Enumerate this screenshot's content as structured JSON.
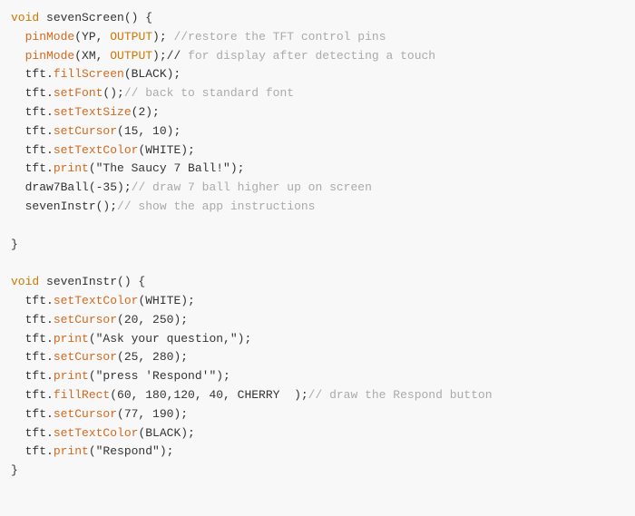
{
  "code": {
    "lines": [
      {
        "id": 1,
        "tokens": [
          {
            "t": "void",
            "c": "kw"
          },
          {
            "t": " sevenScreen() {",
            "c": "plain"
          }
        ]
      },
      {
        "id": 2,
        "tokens": [
          {
            "t": "  pinMode",
            "c": "method"
          },
          {
            "t": "(YP, ",
            "c": "plain"
          },
          {
            "t": "OUTPUT",
            "c": "param"
          },
          {
            "t": "); ",
            "c": "plain"
          },
          {
            "t": "//restore the TFT control pins",
            "c": "comment"
          }
        ]
      },
      {
        "id": 3,
        "tokens": [
          {
            "t": "  pinMode",
            "c": "method"
          },
          {
            "t": "(XM, ",
            "c": "plain"
          },
          {
            "t": "OUTPUT",
            "c": "param"
          },
          {
            "t": ");//",
            "c": "plain"
          },
          {
            "t": " for display after detecting a touch",
            "c": "comment"
          }
        ]
      },
      {
        "id": 4,
        "tokens": [
          {
            "t": "  tft.",
            "c": "plain"
          },
          {
            "t": "fillScreen",
            "c": "method"
          },
          {
            "t": "(BLACK);",
            "c": "plain"
          }
        ]
      },
      {
        "id": 5,
        "tokens": [
          {
            "t": "  tft.",
            "c": "plain"
          },
          {
            "t": "setFont",
            "c": "method"
          },
          {
            "t": "();",
            "c": "plain"
          },
          {
            "t": "// back to standard font",
            "c": "comment"
          }
        ]
      },
      {
        "id": 6,
        "tokens": [
          {
            "t": "  tft.",
            "c": "plain"
          },
          {
            "t": "setTextSize",
            "c": "method"
          },
          {
            "t": "(2);",
            "c": "plain"
          }
        ]
      },
      {
        "id": 7,
        "tokens": [
          {
            "t": "  tft.",
            "c": "plain"
          },
          {
            "t": "setCursor",
            "c": "method"
          },
          {
            "t": "(15, 10);",
            "c": "plain"
          }
        ]
      },
      {
        "id": 8,
        "tokens": [
          {
            "t": "  tft.",
            "c": "plain"
          },
          {
            "t": "setTextColor",
            "c": "method"
          },
          {
            "t": "(WHITE);",
            "c": "plain"
          }
        ]
      },
      {
        "id": 9,
        "tokens": [
          {
            "t": "  tft.",
            "c": "plain"
          },
          {
            "t": "print",
            "c": "method"
          },
          {
            "t": "(\"The Saucy 7 Ball!\");",
            "c": "plain"
          }
        ]
      },
      {
        "id": 10,
        "tokens": [
          {
            "t": "  draw7Ball",
            "c": "plain"
          },
          {
            "t": "(-35);",
            "c": "plain"
          },
          {
            "t": "// draw 7 ball higher up on screen",
            "c": "comment"
          }
        ]
      },
      {
        "id": 11,
        "tokens": [
          {
            "t": "  sevenInstr",
            "c": "plain"
          },
          {
            "t": "();",
            "c": "plain"
          },
          {
            "t": "// show the app instructions",
            "c": "comment"
          }
        ]
      },
      {
        "id": 12,
        "tokens": [
          {
            "t": "",
            "c": "plain"
          }
        ]
      },
      {
        "id": 13,
        "tokens": [
          {
            "t": "}",
            "c": "plain"
          }
        ]
      },
      {
        "id": 14,
        "tokens": [
          {
            "t": "",
            "c": "plain"
          }
        ]
      },
      {
        "id": 15,
        "tokens": [
          {
            "t": "void",
            "c": "kw"
          },
          {
            "t": " sevenInstr() {",
            "c": "plain"
          }
        ]
      },
      {
        "id": 16,
        "tokens": [
          {
            "t": "  tft.",
            "c": "plain"
          },
          {
            "t": "setTextColor",
            "c": "method"
          },
          {
            "t": "(WHITE);",
            "c": "plain"
          }
        ]
      },
      {
        "id": 17,
        "tokens": [
          {
            "t": "  tft.",
            "c": "plain"
          },
          {
            "t": "setCursor",
            "c": "method"
          },
          {
            "t": "(20, 250);",
            "c": "plain"
          }
        ]
      },
      {
        "id": 18,
        "tokens": [
          {
            "t": "  tft.",
            "c": "plain"
          },
          {
            "t": "print",
            "c": "method"
          },
          {
            "t": "(\"Ask your question,\");",
            "c": "plain"
          }
        ]
      },
      {
        "id": 19,
        "tokens": [
          {
            "t": "  tft.",
            "c": "plain"
          },
          {
            "t": "setCursor",
            "c": "method"
          },
          {
            "t": "(25, 280);",
            "c": "plain"
          }
        ]
      },
      {
        "id": 20,
        "tokens": [
          {
            "t": "  tft.",
            "c": "plain"
          },
          {
            "t": "print",
            "c": "method"
          },
          {
            "t": "(\"press 'Respond'\");",
            "c": "plain"
          }
        ]
      },
      {
        "id": 21,
        "tokens": [
          {
            "t": "  tft.",
            "c": "plain"
          },
          {
            "t": "fillRect",
            "c": "method"
          },
          {
            "t": "(60, 180,120, 40, CHERRY  );",
            "c": "plain"
          },
          {
            "t": "// draw the Respond button",
            "c": "comment"
          }
        ]
      },
      {
        "id": 22,
        "tokens": [
          {
            "t": "  tft.",
            "c": "plain"
          },
          {
            "t": "setCursor",
            "c": "method"
          },
          {
            "t": "(77, 190);",
            "c": "plain"
          }
        ]
      },
      {
        "id": 23,
        "tokens": [
          {
            "t": "  tft.",
            "c": "plain"
          },
          {
            "t": "setTextColor",
            "c": "method"
          },
          {
            "t": "(BLACK);",
            "c": "plain"
          }
        ]
      },
      {
        "id": 24,
        "tokens": [
          {
            "t": "  tft.",
            "c": "plain"
          },
          {
            "t": "print",
            "c": "method"
          },
          {
            "t": "(\"Respond\");",
            "c": "plain"
          }
        ]
      },
      {
        "id": 25,
        "tokens": [
          {
            "t": "}",
            "c": "plain"
          }
        ]
      }
    ]
  },
  "colors": {
    "kw": "#cc7700",
    "method": "#d2691e",
    "param": "#cc7700",
    "comment": "#aaaaaa",
    "plain": "#333333",
    "bg": "#f8f8f8"
  }
}
